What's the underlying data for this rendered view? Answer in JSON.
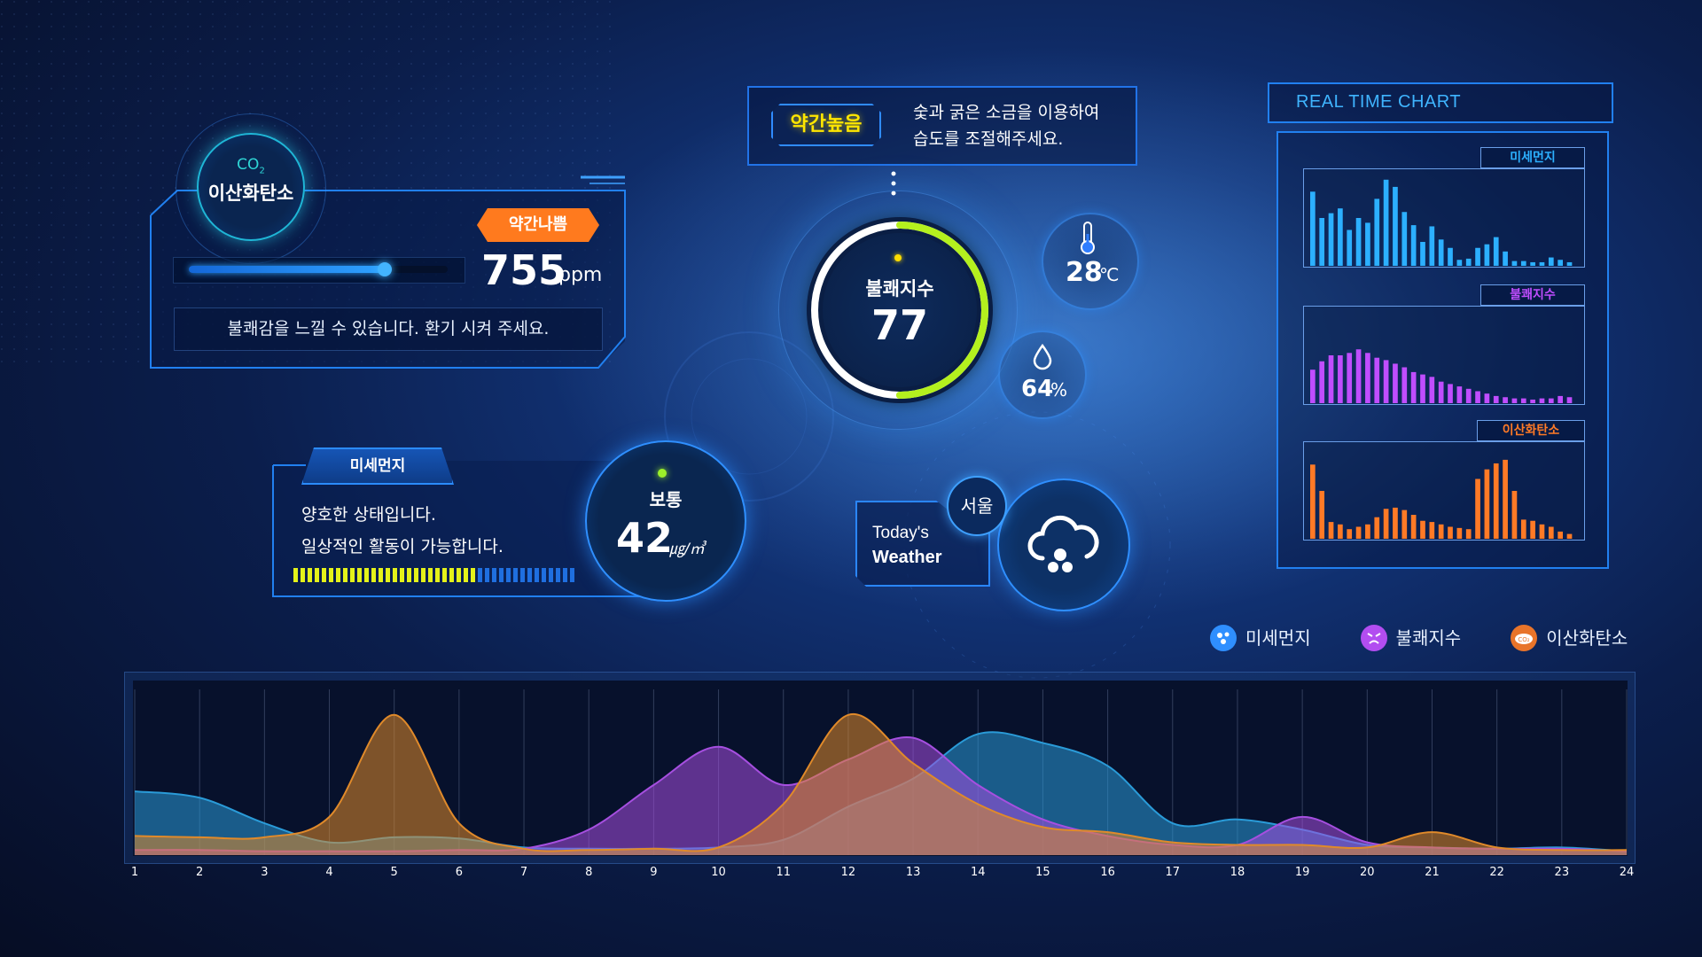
{
  "co2": {
    "chem_label": "CO",
    "chem_sub": "2",
    "name": "이산화탄소",
    "status": "약간나쁨",
    "value": "755",
    "unit": "ppm",
    "level": 0.75,
    "message": "불쾌감을 느낄 수 있습니다. 환기 시켜 주세요."
  },
  "notice": {
    "badge": "약간높음",
    "line1": "숯과 굵은 소금을 이용하여",
    "line2": "습도를 조절해주세요."
  },
  "discomfort": {
    "label": "불쾌지수",
    "value": "77",
    "level": 0.77
  },
  "temperature": {
    "value": "28",
    "unit": "℃"
  },
  "humidity": {
    "value": "64",
    "unit": "%"
  },
  "dust": {
    "tab": "미세먼지",
    "line1": "양호한 상태입니다.",
    "line2": "일상적인 활동이 가능합니다.",
    "status": "보통",
    "value": "42",
    "unit": "㎍/㎥",
    "level_segments_on": 26,
    "level_segments_total": 40
  },
  "weather": {
    "line1": "Today's",
    "line2": "Weather",
    "city": "서울",
    "icon": "snow-cloud-icon"
  },
  "realtime": {
    "title": "REAL TIME CHART",
    "panels": [
      {
        "label": "미세먼지",
        "color": "#2cb0ff",
        "values": [
          62,
          40,
          44,
          48,
          30,
          40,
          36,
          56,
          72,
          66,
          45,
          34,
          20,
          33,
          22,
          15,
          5,
          6,
          15,
          18,
          24,
          12,
          4,
          4,
          3,
          3,
          7,
          5,
          3
        ]
      },
      {
        "label": "불쾌지수",
        "color": "#c04dff",
        "values": [
          28,
          35,
          40,
          40,
          42,
          45,
          42,
          38,
          36,
          33,
          30,
          26,
          24,
          22,
          18,
          16,
          14,
          12,
          10,
          8,
          6,
          5,
          4,
          4,
          3,
          4,
          4,
          6,
          5
        ]
      },
      {
        "label": "이산화탄소",
        "color": "#ff7a26",
        "values": [
          62,
          40,
          14,
          12,
          8,
          10,
          12,
          18,
          25,
          26,
          24,
          20,
          15,
          14,
          12,
          10,
          9,
          8,
          50,
          58,
          63,
          66,
          40,
          16,
          15,
          12,
          10,
          6,
          4
        ]
      }
    ]
  },
  "legend": [
    {
      "label": "미세먼지",
      "color": "#2f8fff",
      "icon": "dust-particles-icon"
    },
    {
      "label": "불쾌지수",
      "color": "#b24df0",
      "icon": "angry-face-icon"
    },
    {
      "label": "이산화탄소",
      "color": "#e8742a",
      "icon": "co2-cloud-icon"
    }
  ],
  "chart_data": {
    "type": "area",
    "x": [
      1,
      2,
      3,
      4,
      5,
      6,
      7,
      8,
      9,
      10,
      11,
      12,
      13,
      14,
      15,
      16,
      17,
      18,
      19,
      20,
      21,
      22,
      23,
      24
    ],
    "series": [
      {
        "name": "미세먼지",
        "color": "#2a9bd8",
        "values": [
          50,
          45,
          25,
          10,
          14,
          13,
          6,
          5,
          5,
          6,
          12,
          38,
          60,
          95,
          88,
          70,
          25,
          28,
          20,
          8,
          6,
          5,
          6,
          3
        ]
      },
      {
        "name": "불쾌지수",
        "color": "#a64fe0",
        "values": [
          4,
          4,
          3,
          3,
          3,
          4,
          5,
          20,
          55,
          85,
          55,
          75,
          92,
          55,
          28,
          15,
          8,
          8,
          30,
          10,
          6,
          5,
          5,
          3
        ]
      },
      {
        "name": "이산화탄소",
        "color": "#e08a2a",
        "values": [
          15,
          14,
          14,
          30,
          110,
          25,
          5,
          4,
          5,
          6,
          40,
          110,
          72,
          40,
          22,
          18,
          10,
          8,
          8,
          6,
          18,
          6,
          4,
          4
        ]
      }
    ],
    "xlim": [
      1,
      24
    ],
    "ylim": [
      0,
      130
    ],
    "grid": true
  }
}
